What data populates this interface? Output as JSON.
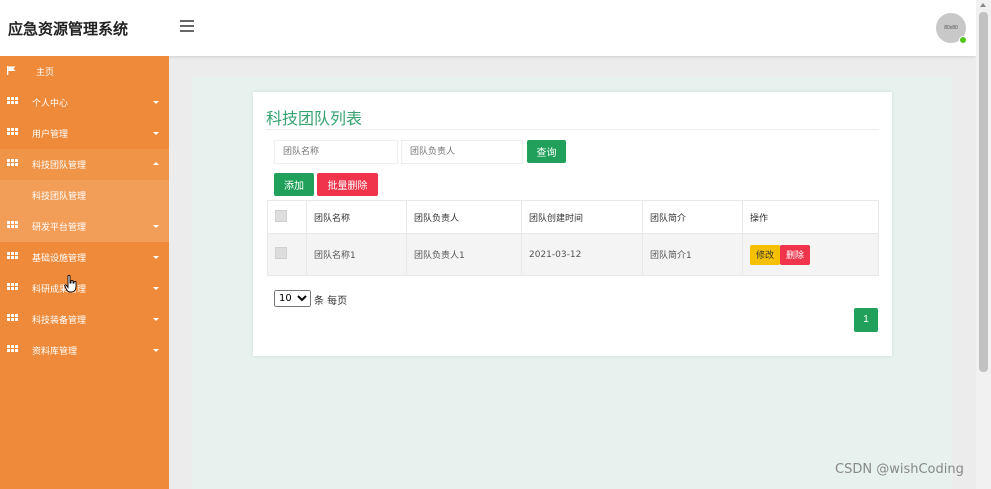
{
  "header": {
    "app_title": "应急资源管理系统",
    "avatar_text": "80x80"
  },
  "sidebar": {
    "items": [
      {
        "label": "主页",
        "icon": "flag-icon",
        "has_caret": false
      },
      {
        "label": "个人中心",
        "icon": "grid-icon",
        "has_caret": true
      },
      {
        "label": "用户管理",
        "icon": "grid-icon",
        "has_caret": true
      },
      {
        "label": "科技团队管理",
        "icon": "grid-icon",
        "has_caret": true,
        "expanded": true
      },
      {
        "label": "科技团队管理",
        "sub": true
      },
      {
        "label": "研发平台管理",
        "icon": "grid-icon",
        "has_caret": true
      },
      {
        "label": "基础设施管理",
        "icon": "grid-icon",
        "has_caret": true
      },
      {
        "label": "科研成果管理",
        "icon": "grid-icon",
        "has_caret": true
      },
      {
        "label": "科技装备管理",
        "icon": "grid-icon",
        "has_caret": true
      },
      {
        "label": "资料库管理",
        "icon": "grid-icon",
        "has_caret": true
      }
    ]
  },
  "main": {
    "title": "科技团队列表",
    "search": {
      "name_placeholder": "团队名称",
      "leader_placeholder": "团队负责人",
      "search_label": "查询"
    },
    "actions": {
      "add_label": "添加",
      "batch_delete_label": "批量删除"
    },
    "table": {
      "headers": [
        "团队名称",
        "团队负责人",
        "团队创建时间",
        "团队简介",
        "操作"
      ],
      "rows": [
        {
          "name": "团队名称1",
          "leader": "团队负责人1",
          "created": "2021-03-12",
          "intro": "团队简介1",
          "edit_label": "修改",
          "delete_label": "删除"
        }
      ]
    },
    "pagination": {
      "page_size": "10",
      "page_size_options": [
        "10"
      ],
      "per_page_label": "条 每页",
      "current_page": "1"
    }
  },
  "watermark": "CSDN @wishCoding",
  "colors": {
    "sidebar": "#ef8a3a",
    "primary": "#20a05a",
    "danger": "#f0344b",
    "warning": "#f5c000",
    "title": "#36a36f"
  }
}
